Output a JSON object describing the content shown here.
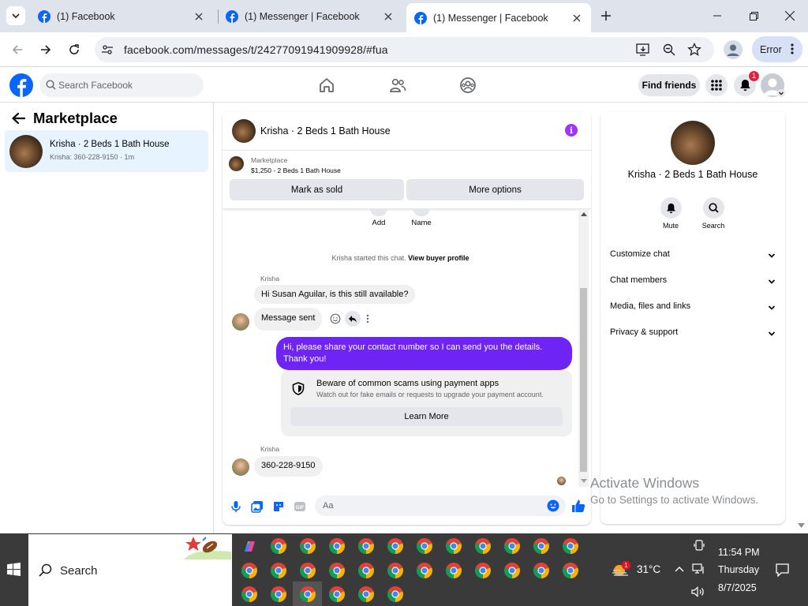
{
  "browser": {
    "tabs": [
      {
        "title": "(1) Facebook",
        "active": false
      },
      {
        "title": "(1) Messenger | Facebook",
        "active": false
      },
      {
        "title": "(1) Messenger | Facebook",
        "active": true
      }
    ],
    "url": "facebook.com/messages/t/24277091941909928/#fua",
    "profile_error_label": "Error"
  },
  "fb_nav": {
    "search_placeholder": "Search Facebook",
    "find_friends_label": "Find friends",
    "notification_count": "1"
  },
  "left_panel": {
    "title": "Marketplace",
    "conversation": {
      "name": "Krisha · 2 Beds 1 Bath House",
      "preview": "Krisha: 360-228-9150 · 1m"
    }
  },
  "chat": {
    "header_title": "Krisha · 2 Beds 1 Bath House",
    "listing": {
      "category": "Marketplace",
      "price_title": "$1,250 - 2 Beds 1 Bath House",
      "mark_sold_label": "Mark as sold",
      "more_options_label": "More options"
    },
    "top_actions": [
      {
        "label": "Add"
      },
      {
        "label": "Name"
      }
    ],
    "started_text": "Krisha started this chat.",
    "view_profile_link": "View buyer profile",
    "messages": [
      {
        "sender": "Krisha",
        "text": "Hi Susan Aguilar, is this still available?",
        "direction": "in"
      },
      {
        "text": "Message sent",
        "direction": "in"
      },
      {
        "text": "Hi, please share your contact number so I can send you the details. Thank you!",
        "direction": "out"
      },
      {
        "sender": "Krisha",
        "text": "360-228-9150",
        "direction": "in"
      }
    ],
    "scam_notice": {
      "title": "Beware of common scams using payment apps",
      "subtitle": "Watch out for fake emails or requests to upgrade your payment account.",
      "button_label": "Learn More"
    },
    "composer_placeholder": "Aa",
    "colors": {
      "accent": "#6e24f5",
      "info": "#a033ff",
      "like": "#0866ff"
    }
  },
  "right_panel": {
    "title": "Krisha · 2 Beds 1 Bath House",
    "actions": [
      {
        "label": "Mute",
        "icon": "bell-icon"
      },
      {
        "label": "Search",
        "icon": "search-icon"
      }
    ],
    "sections": [
      {
        "label": "Customize chat"
      },
      {
        "label": "Chat members"
      },
      {
        "label": "Media, files and links"
      },
      {
        "label": "Privacy & support"
      }
    ]
  },
  "watermark": {
    "title": "Activate Windows",
    "subtitle": "Go to Settings to activate Windows."
  },
  "taskbar": {
    "search_label": "Search",
    "weather_temp": "31°C",
    "weather_badge": "1",
    "time": "11:54 PM",
    "day": "Thursday",
    "date": "8/7/2025"
  }
}
